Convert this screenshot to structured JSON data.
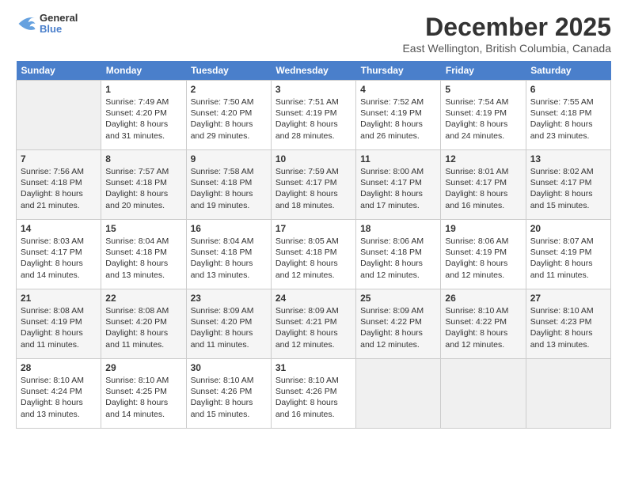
{
  "logo": {
    "text_general": "General",
    "text_blue": "Blue"
  },
  "header": {
    "month_year": "December 2025",
    "location": "East Wellington, British Columbia, Canada"
  },
  "days_of_week": [
    "Sunday",
    "Monday",
    "Tuesday",
    "Wednesday",
    "Thursday",
    "Friday",
    "Saturday"
  ],
  "weeks": [
    [
      {
        "day": "",
        "data": ""
      },
      {
        "day": "1",
        "data": "Sunrise: 7:49 AM\nSunset: 4:20 PM\nDaylight: 8 hours\nand 31 minutes."
      },
      {
        "day": "2",
        "data": "Sunrise: 7:50 AM\nSunset: 4:20 PM\nDaylight: 8 hours\nand 29 minutes."
      },
      {
        "day": "3",
        "data": "Sunrise: 7:51 AM\nSunset: 4:19 PM\nDaylight: 8 hours\nand 28 minutes."
      },
      {
        "day": "4",
        "data": "Sunrise: 7:52 AM\nSunset: 4:19 PM\nDaylight: 8 hours\nand 26 minutes."
      },
      {
        "day": "5",
        "data": "Sunrise: 7:54 AM\nSunset: 4:19 PM\nDaylight: 8 hours\nand 24 minutes."
      },
      {
        "day": "6",
        "data": "Sunrise: 7:55 AM\nSunset: 4:18 PM\nDaylight: 8 hours\nand 23 minutes."
      }
    ],
    [
      {
        "day": "7",
        "data": "Sunrise: 7:56 AM\nSunset: 4:18 PM\nDaylight: 8 hours\nand 21 minutes."
      },
      {
        "day": "8",
        "data": "Sunrise: 7:57 AM\nSunset: 4:18 PM\nDaylight: 8 hours\nand 20 minutes."
      },
      {
        "day": "9",
        "data": "Sunrise: 7:58 AM\nSunset: 4:18 PM\nDaylight: 8 hours\nand 19 minutes."
      },
      {
        "day": "10",
        "data": "Sunrise: 7:59 AM\nSunset: 4:17 PM\nDaylight: 8 hours\nand 18 minutes."
      },
      {
        "day": "11",
        "data": "Sunrise: 8:00 AM\nSunset: 4:17 PM\nDaylight: 8 hours\nand 17 minutes."
      },
      {
        "day": "12",
        "data": "Sunrise: 8:01 AM\nSunset: 4:17 PM\nDaylight: 8 hours\nand 16 minutes."
      },
      {
        "day": "13",
        "data": "Sunrise: 8:02 AM\nSunset: 4:17 PM\nDaylight: 8 hours\nand 15 minutes."
      }
    ],
    [
      {
        "day": "14",
        "data": "Sunrise: 8:03 AM\nSunset: 4:17 PM\nDaylight: 8 hours\nand 14 minutes."
      },
      {
        "day": "15",
        "data": "Sunrise: 8:04 AM\nSunset: 4:18 PM\nDaylight: 8 hours\nand 13 minutes."
      },
      {
        "day": "16",
        "data": "Sunrise: 8:04 AM\nSunset: 4:18 PM\nDaylight: 8 hours\nand 13 minutes."
      },
      {
        "day": "17",
        "data": "Sunrise: 8:05 AM\nSunset: 4:18 PM\nDaylight: 8 hours\nand 12 minutes."
      },
      {
        "day": "18",
        "data": "Sunrise: 8:06 AM\nSunset: 4:18 PM\nDaylight: 8 hours\nand 12 minutes."
      },
      {
        "day": "19",
        "data": "Sunrise: 8:06 AM\nSunset: 4:19 PM\nDaylight: 8 hours\nand 12 minutes."
      },
      {
        "day": "20",
        "data": "Sunrise: 8:07 AM\nSunset: 4:19 PM\nDaylight: 8 hours\nand 11 minutes."
      }
    ],
    [
      {
        "day": "21",
        "data": "Sunrise: 8:08 AM\nSunset: 4:19 PM\nDaylight: 8 hours\nand 11 minutes."
      },
      {
        "day": "22",
        "data": "Sunrise: 8:08 AM\nSunset: 4:20 PM\nDaylight: 8 hours\nand 11 minutes."
      },
      {
        "day": "23",
        "data": "Sunrise: 8:09 AM\nSunset: 4:20 PM\nDaylight: 8 hours\nand 11 minutes."
      },
      {
        "day": "24",
        "data": "Sunrise: 8:09 AM\nSunset: 4:21 PM\nDaylight: 8 hours\nand 12 minutes."
      },
      {
        "day": "25",
        "data": "Sunrise: 8:09 AM\nSunset: 4:22 PM\nDaylight: 8 hours\nand 12 minutes."
      },
      {
        "day": "26",
        "data": "Sunrise: 8:10 AM\nSunset: 4:22 PM\nDaylight: 8 hours\nand 12 minutes."
      },
      {
        "day": "27",
        "data": "Sunrise: 8:10 AM\nSunset: 4:23 PM\nDaylight: 8 hours\nand 13 minutes."
      }
    ],
    [
      {
        "day": "28",
        "data": "Sunrise: 8:10 AM\nSunset: 4:24 PM\nDaylight: 8 hours\nand 13 minutes."
      },
      {
        "day": "29",
        "data": "Sunrise: 8:10 AM\nSunset: 4:25 PM\nDaylight: 8 hours\nand 14 minutes."
      },
      {
        "day": "30",
        "data": "Sunrise: 8:10 AM\nSunset: 4:26 PM\nDaylight: 8 hours\nand 15 minutes."
      },
      {
        "day": "31",
        "data": "Sunrise: 8:10 AM\nSunset: 4:26 PM\nDaylight: 8 hours\nand 16 minutes."
      },
      {
        "day": "",
        "data": ""
      },
      {
        "day": "",
        "data": ""
      },
      {
        "day": "",
        "data": ""
      }
    ]
  ]
}
